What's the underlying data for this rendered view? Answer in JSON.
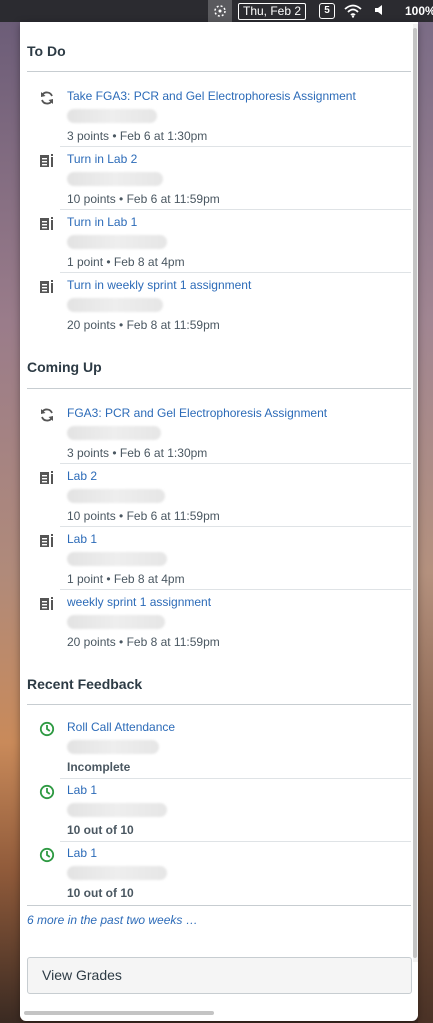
{
  "menubar": {
    "date": "Thu, Feb 2",
    "battery": "100%",
    "notification_badge": "5"
  },
  "todo": {
    "title": "To Do",
    "items": [
      {
        "icon": "quiz-icon",
        "title": "Take FGA3: PCR and Gel Electrophoresis Assignment",
        "meta": "3 points • Feb 6 at 1:30pm"
      },
      {
        "icon": "assignment-icon",
        "title": "Turn in Lab 2",
        "meta": "10 points • Feb 6 at 11:59pm"
      },
      {
        "icon": "assignment-icon",
        "title": "Turn in Lab 1",
        "meta": "1 point • Feb 8 at 4pm"
      },
      {
        "icon": "assignment-icon",
        "title": "Turn in weekly sprint 1 assignment",
        "meta": "20 points • Feb 8 at 11:59pm"
      }
    ]
  },
  "coming_up": {
    "title": "Coming Up",
    "items": [
      {
        "icon": "quiz-icon",
        "title": "FGA3: PCR and Gel Electrophoresis Assignment",
        "meta": "3 points • Feb 6 at 1:30pm"
      },
      {
        "icon": "assignment-icon",
        "title": "Lab 2",
        "meta": "10 points • Feb 6 at 11:59pm"
      },
      {
        "icon": "assignment-icon",
        "title": "Lab 1",
        "meta": "1 point • Feb 8 at 4pm"
      },
      {
        "icon": "assignment-icon",
        "title": "weekly sprint 1 assignment",
        "meta": "20 points • Feb 8 at 11:59pm"
      }
    ]
  },
  "recent_feedback": {
    "title": "Recent Feedback",
    "items": [
      {
        "icon": "clock-icon",
        "title": "Roll Call Attendance",
        "meta": "Incomplete"
      },
      {
        "icon": "clock-icon",
        "title": "Lab 1",
        "meta": "10 out of 10"
      },
      {
        "icon": "clock-icon",
        "title": "Lab 1",
        "meta": "10 out of 10"
      }
    ],
    "more_link": "6 more in the past two weeks …"
  },
  "view_grades_label": "View Grades",
  "colors": {
    "link": "#2c6bb8",
    "feedback_icon": "#2f9a43",
    "text": "#2d3b45"
  }
}
